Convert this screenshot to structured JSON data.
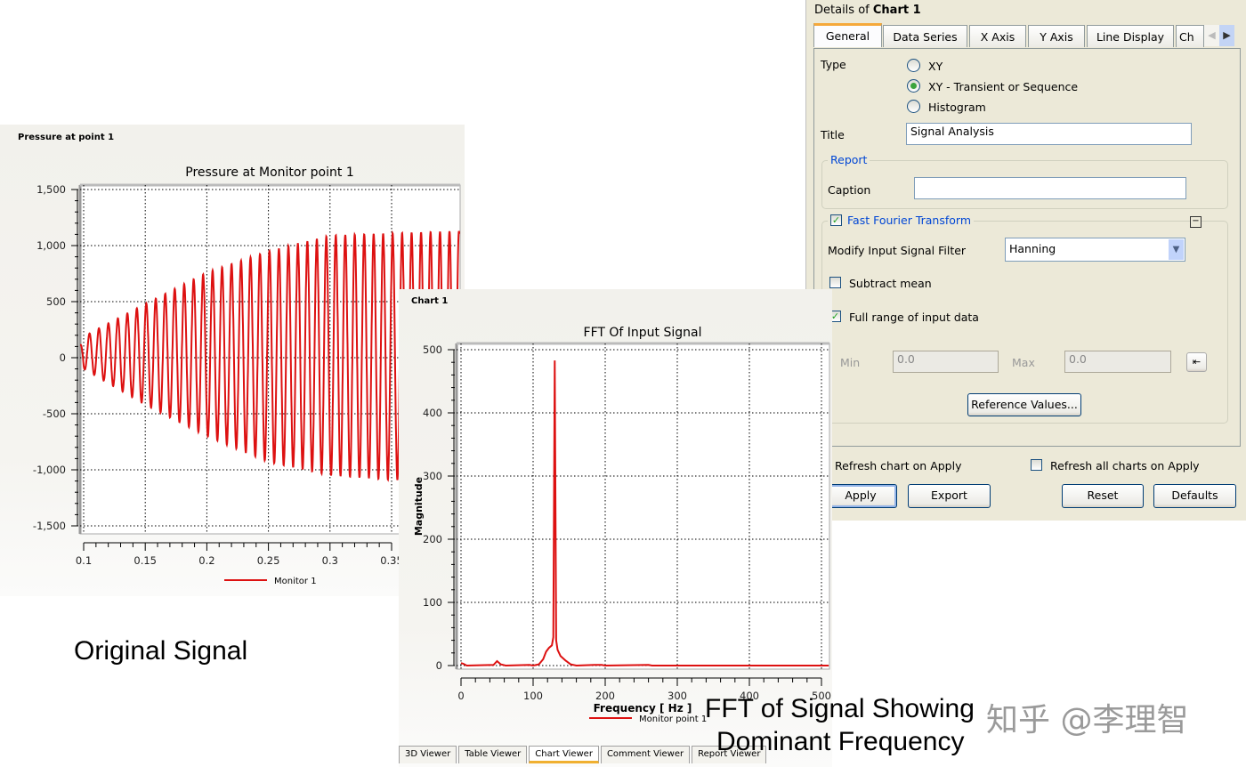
{
  "slide": {
    "original_label": "Original Signal",
    "fft_label_line1": "FFT of Signal Showing",
    "fft_label_line2": "Dominant Frequency",
    "watermark": "知乎 @李理智"
  },
  "colors": {
    "series": "#dd1111",
    "panel_bg": "#ece9d8",
    "accent_tab": "#f5a83a",
    "group_title": "#0046d5"
  },
  "pressure_panel": {
    "header": "Pressure at point 1"
  },
  "fft_panel": {
    "header": "Chart 1",
    "viewer_tabs": [
      {
        "label": "3D Viewer",
        "active": false
      },
      {
        "label": "Table Viewer",
        "active": false
      },
      {
        "label": "Chart Viewer",
        "active": true
      },
      {
        "label": "Comment Viewer",
        "active": false
      },
      {
        "label": "Report Viewer",
        "active": false
      }
    ]
  },
  "chart_data": [
    {
      "type": "line",
      "title": "Pressure at Monitor point 1",
      "xlabel": "",
      "ylabel": "",
      "xlim": [
        0.097,
        0.405
      ],
      "ylim": [
        -1500,
        1500
      ],
      "xticks": [
        "0.1",
        "0.15",
        "0.2",
        "0.25",
        "0.3",
        "0.35"
      ],
      "yticks": [
        "1,500",
        "1,000",
        "500",
        "0",
        "-500",
        "-1,000",
        "-1,500"
      ],
      "grid": true,
      "legend": "bottom",
      "series": [
        {
          "name": "Monitor 1",
          "oscillation_frequency_hz": 130,
          "upper_envelope": {
            "t": [
              0.097,
              0.105,
              0.15,
              0.2,
              0.25,
              0.3,
              0.35,
              0.405
            ],
            "y": [
              110,
              220,
              480,
              760,
              950,
              1090,
              1110,
              1130
            ]
          },
          "lower_envelope": {
            "t": [
              0.097,
              0.1,
              0.15,
              0.2,
              0.25,
              0.3,
              0.35,
              0.405
            ],
            "y": [
              90,
              -100,
              -420,
              -700,
              -930,
              -1050,
              -1090,
              -1100
            ]
          }
        }
      ]
    },
    {
      "type": "line",
      "title": "FFT Of Input Signal",
      "xlabel": "Frequency [ Hz ]",
      "ylabel": "Magnitude",
      "xlim": [
        0,
        510
      ],
      "ylim": [
        0,
        500
      ],
      "xticks": [
        "0",
        "100",
        "200",
        "300",
        "400",
        "500"
      ],
      "yticks": [
        "500",
        "400",
        "300",
        "200",
        "100",
        "0"
      ],
      "grid": true,
      "legend": "bottom",
      "series": [
        {
          "name": "Monitor point 1",
          "x": [
            0,
            3,
            8,
            45,
            50,
            55,
            62,
            95,
            100,
            108,
            114,
            118,
            122,
            126,
            128,
            130,
            132,
            134,
            138,
            145,
            152,
            160,
            185,
            195,
            200,
            260,
            265,
            510
          ],
          "y": [
            4,
            3,
            0,
            1,
            7,
            2,
            0,
            1,
            0,
            2,
            10,
            22,
            28,
            32,
            45,
            483,
            40,
            25,
            15,
            8,
            2,
            0,
            1,
            1,
            0,
            1,
            0,
            0
          ]
        }
      ]
    }
  ],
  "details": {
    "title_prefix": "Details of ",
    "title_bold": "Chart 1",
    "tabs": [
      "General",
      "Data Series",
      "X Axis",
      "Y Axis",
      "Line Display",
      "Ch"
    ],
    "type_label": "Type",
    "type_options": [
      {
        "label": "XY",
        "selected": false
      },
      {
        "label": "XY - Transient or Sequence",
        "selected": true
      },
      {
        "label": "Histogram",
        "selected": false
      }
    ],
    "chart_title_label": "Title",
    "chart_title_value": "Signal Analysis",
    "report_group": "Report",
    "caption_label": "Caption",
    "caption_value": "",
    "fft_group": "Fast Fourier Transform",
    "fft_enabled": true,
    "filter_label": "Modify Input Signal Filter",
    "filter_value": "Hanning",
    "subtract_mean_label": "Subtract mean",
    "subtract_mean": false,
    "full_range_label": "Full range of input data",
    "full_range": true,
    "min_label": "Min",
    "min_value": "0.0",
    "max_label": "Max",
    "max_value": "0.0",
    "reference_button": "Reference Values...",
    "refresh_chart_label": "Refresh chart on Apply",
    "refresh_all_label": "Refresh all charts on Apply",
    "refresh_all": false,
    "buttons": {
      "apply": "Apply",
      "export": "Export",
      "reset": "Reset",
      "defaults": "Defaults"
    }
  }
}
